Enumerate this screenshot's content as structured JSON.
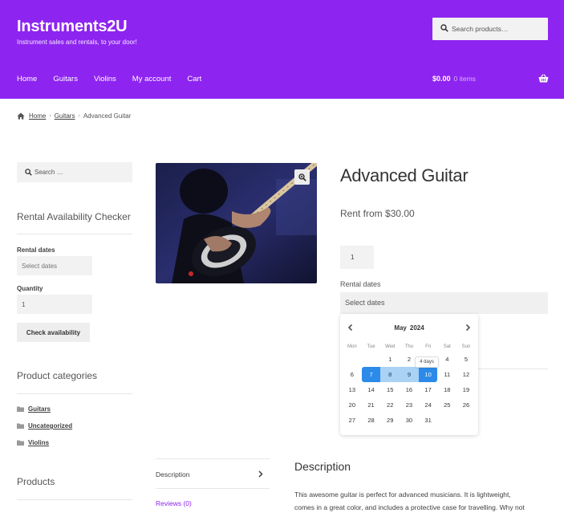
{
  "header": {
    "site_title": "Instruments2U",
    "site_description": "Instrument sales and rentals, to your door!",
    "search_placeholder": "Search products…",
    "nav": [
      "Home",
      "Guitars",
      "Violins",
      "My account",
      "Cart"
    ],
    "cart_total": "$0.00",
    "cart_count": "0 items",
    "brand_color": "#8e24f0"
  },
  "breadcrumb": {
    "home": "Home",
    "category": "Guitars",
    "current": "Advanced Guitar"
  },
  "sidebar": {
    "search_placeholder": "Search …",
    "availability_title": "Rental Availability Checker",
    "rental_dates_label": "Rental dates",
    "rental_dates_placeholder": "Select dates",
    "quantity_label": "Quantity",
    "quantity_value": "1",
    "check_button": "Check availability",
    "categories_title": "Product categories",
    "categories": [
      "Guitars",
      "Uncategorized",
      "Violins"
    ],
    "products_title": "Products"
  },
  "product": {
    "title": "Advanced Guitar",
    "price": "Rent from $30.00",
    "quantity": "1",
    "rental_dates_label": "Rental dates",
    "rental_dates_placeholder": "Select dates"
  },
  "datepicker": {
    "month": "May",
    "year": "2024",
    "weekdays": [
      "Mon",
      "Tue",
      "Wed",
      "Thu",
      "Fri",
      "Sat",
      "Sun"
    ],
    "leading_blanks": 2,
    "days_in_month": 31,
    "range_start": 7,
    "range_end": 10,
    "tooltip": "4 days",
    "tooltip_day": 3,
    "selected_color": "#2c8ae8",
    "range_color": "#a9d2f5"
  },
  "tabs": {
    "description": "Description",
    "reviews": "Reviews (0)"
  },
  "description": {
    "title": "Description",
    "text_line1": "This awesome guitar is perfect for advanced musicians. It is lightweight,",
    "text_line2": "comes in a great color, and includes a protective case for travelling. Why not"
  }
}
